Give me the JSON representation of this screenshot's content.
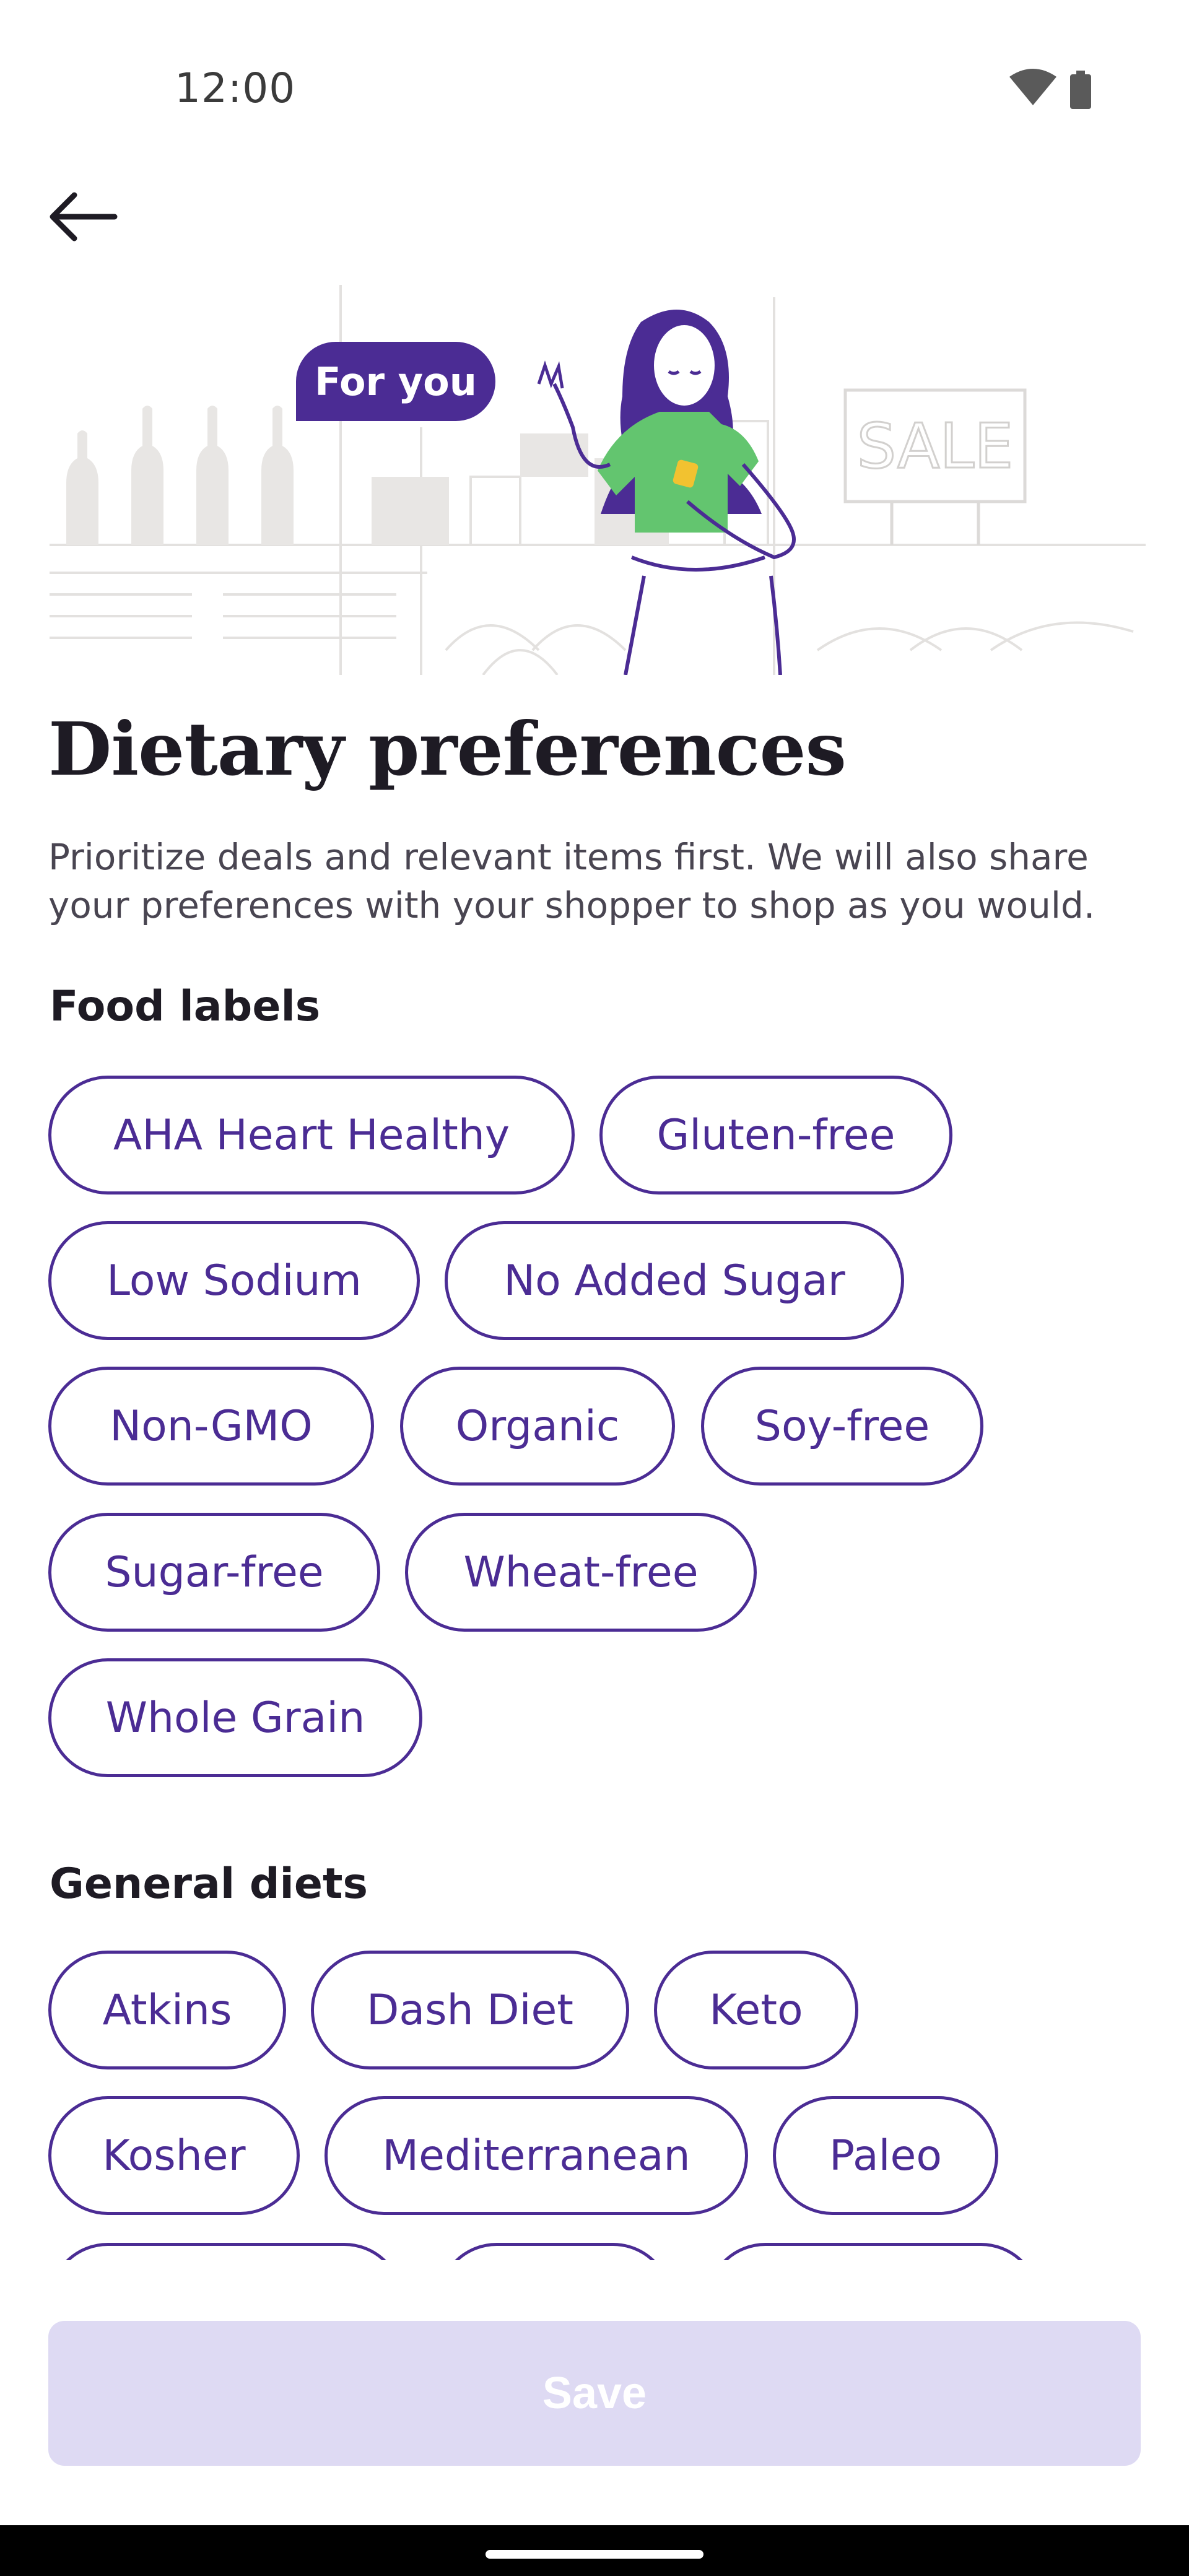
{
  "status_bar": {
    "time": "12:00",
    "icons": [
      "wifi-icon",
      "battery-icon"
    ]
  },
  "header": {
    "back_icon": "arrow-left-icon"
  },
  "hero": {
    "badge": "For you",
    "sign_text": "SALE"
  },
  "title": "Dietary preferences",
  "description": "Prioritize deals and relevant items first. We will also share your preferences with your shopper to shop as you would.",
  "food_labels": {
    "title": "Food labels",
    "items": [
      "AHA Heart Healthy",
      "Gluten-free",
      "Low Sodium",
      "No Added Sugar",
      "Non-GMO",
      "Organic",
      "Soy-free",
      "Sugar-free",
      "Wheat-free",
      "Whole Grain"
    ]
  },
  "general_diets": {
    "title": "General diets",
    "items": [
      "Atkins",
      "Dash Diet",
      "Keto",
      "Kosher",
      "Mediterranean",
      "Paleo"
    ]
  },
  "save_button": {
    "label": "Save"
  },
  "colors": {
    "accent": "#4b2c94",
    "save_disabled_bg": "#dedaf3",
    "shirt": "#63c56f",
    "illustration_gray": "#e8e6e4"
  }
}
